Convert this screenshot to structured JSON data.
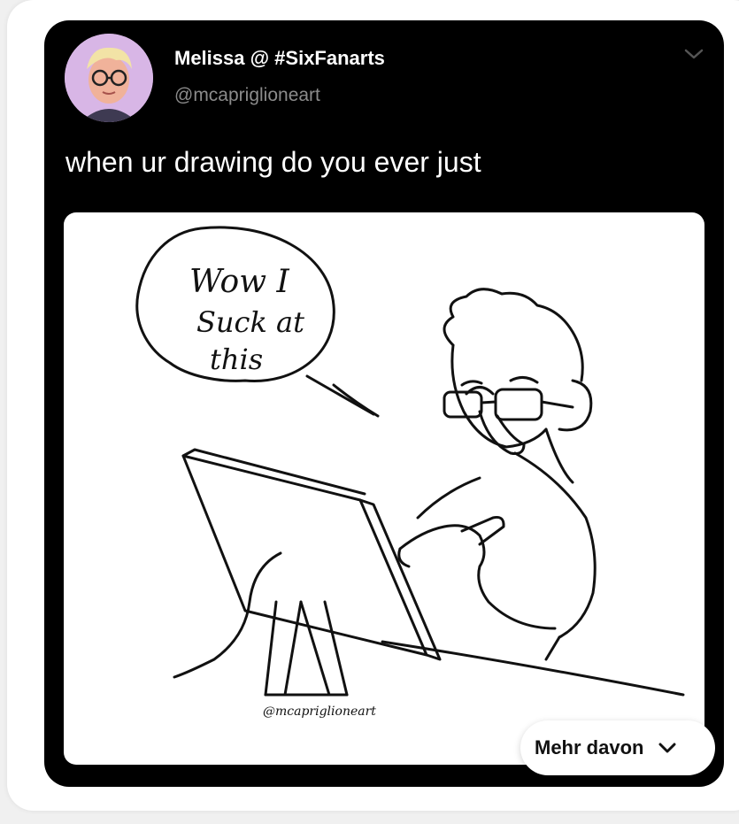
{
  "post": {
    "display_name": "Melissa @ #SixFanarts",
    "handle": "@mcapriglioneart",
    "text": "when ur drawing do you ever just",
    "menu_icon": "chevron-down-icon",
    "image": {
      "speech_bubble_lines": [
        "Wow I",
        "Suck at",
        "this"
      ],
      "signature": "@mcapriglioneart"
    }
  },
  "more_button": {
    "label": "Mehr davon",
    "icon": "chevron-down-icon"
  },
  "colors": {
    "page_background": "#f0f0f0",
    "card_background": "#ffffff",
    "tweet_background": "#000000",
    "handle_gray": "#8b8b8b",
    "avatar_background": "#d8b6e6"
  }
}
